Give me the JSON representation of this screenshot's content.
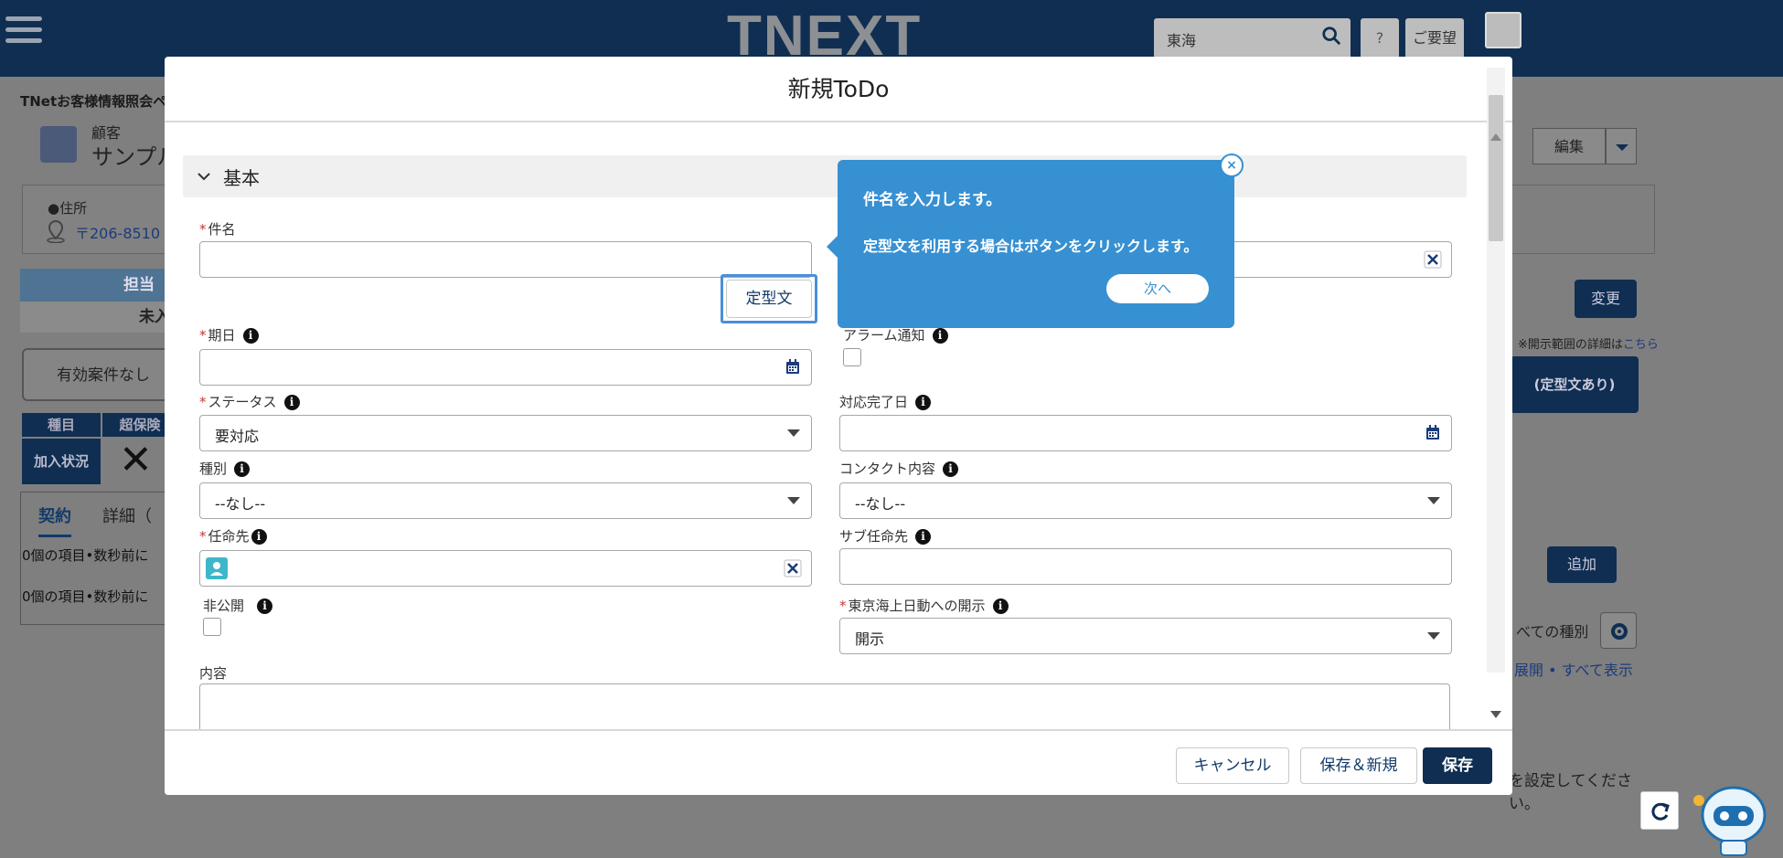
{
  "app": {
    "logo_text": "TNEXT",
    "search_value": "東海",
    "help_label": "?",
    "request_label": "ご要望"
  },
  "background_page": {
    "breadcrumb": "TNetお客様情報照会ペ",
    "customer_label": "顧客",
    "customer_name": "サンプル",
    "address_label": "●住所",
    "address_value": "〒206-8510",
    "tanto_header": "担当（",
    "tanto_value": "未入",
    "case_none": "有効案件なし",
    "shumoku_header": "種目",
    "chohoken_header": "超保険",
    "kanyu_label": "加入状況",
    "kanyu_mark": "✕",
    "tab_keiyaku": "契約",
    "tab_shosai": "詳細（",
    "items_1": "0個の項目•数秒前に",
    "items_2": "0個の項目•数秒前に",
    "edit_label": "編集",
    "change_label": "変更",
    "disclosure_note": "※開示範囲の詳細は",
    "disclosure_link": "こちら",
    "teikei_label": "(定型文あり)",
    "add_label": "追加",
    "all_types": "べての種別",
    "expand_label": "展開 • すべて表示",
    "set_label": "を設定してくださ\nい。"
  },
  "modal": {
    "title": "新規ToDo",
    "section_title": "基本",
    "fields": {
      "subject_label": "件名",
      "subject_value": "",
      "teikei_button": "定型文",
      "due_label": "期日",
      "due_value": "",
      "alarm_label": "アラーム通知",
      "status_label": "ステータス",
      "status_value": "要対応",
      "complete_label": "対応完了日",
      "complete_value": "",
      "type_label": "種別",
      "type_value": "--なし--",
      "contact_label": "コンタクト内容",
      "contact_value": "--なし--",
      "assignee_label": "任命先",
      "sub_assignee_label": "サブ任命先",
      "private_label": "非公開",
      "disclose_label": "東京海上日動への開示",
      "disclose_value": "開示",
      "content_label": "内容"
    },
    "buttons": {
      "cancel": "キャンセル",
      "save_new": "保存＆新規",
      "save": "保存"
    }
  },
  "tooltip": {
    "line1": "件名を入力します。",
    "line2": "定型文を利用する場合はボタンをクリックします。",
    "next": "次へ",
    "close": "×"
  },
  "colors": {
    "header_bg": "#0f2e52",
    "tooltip_bg": "#3790d2",
    "primary_button": "#0f2e52",
    "required_mark": "#c23934"
  }
}
